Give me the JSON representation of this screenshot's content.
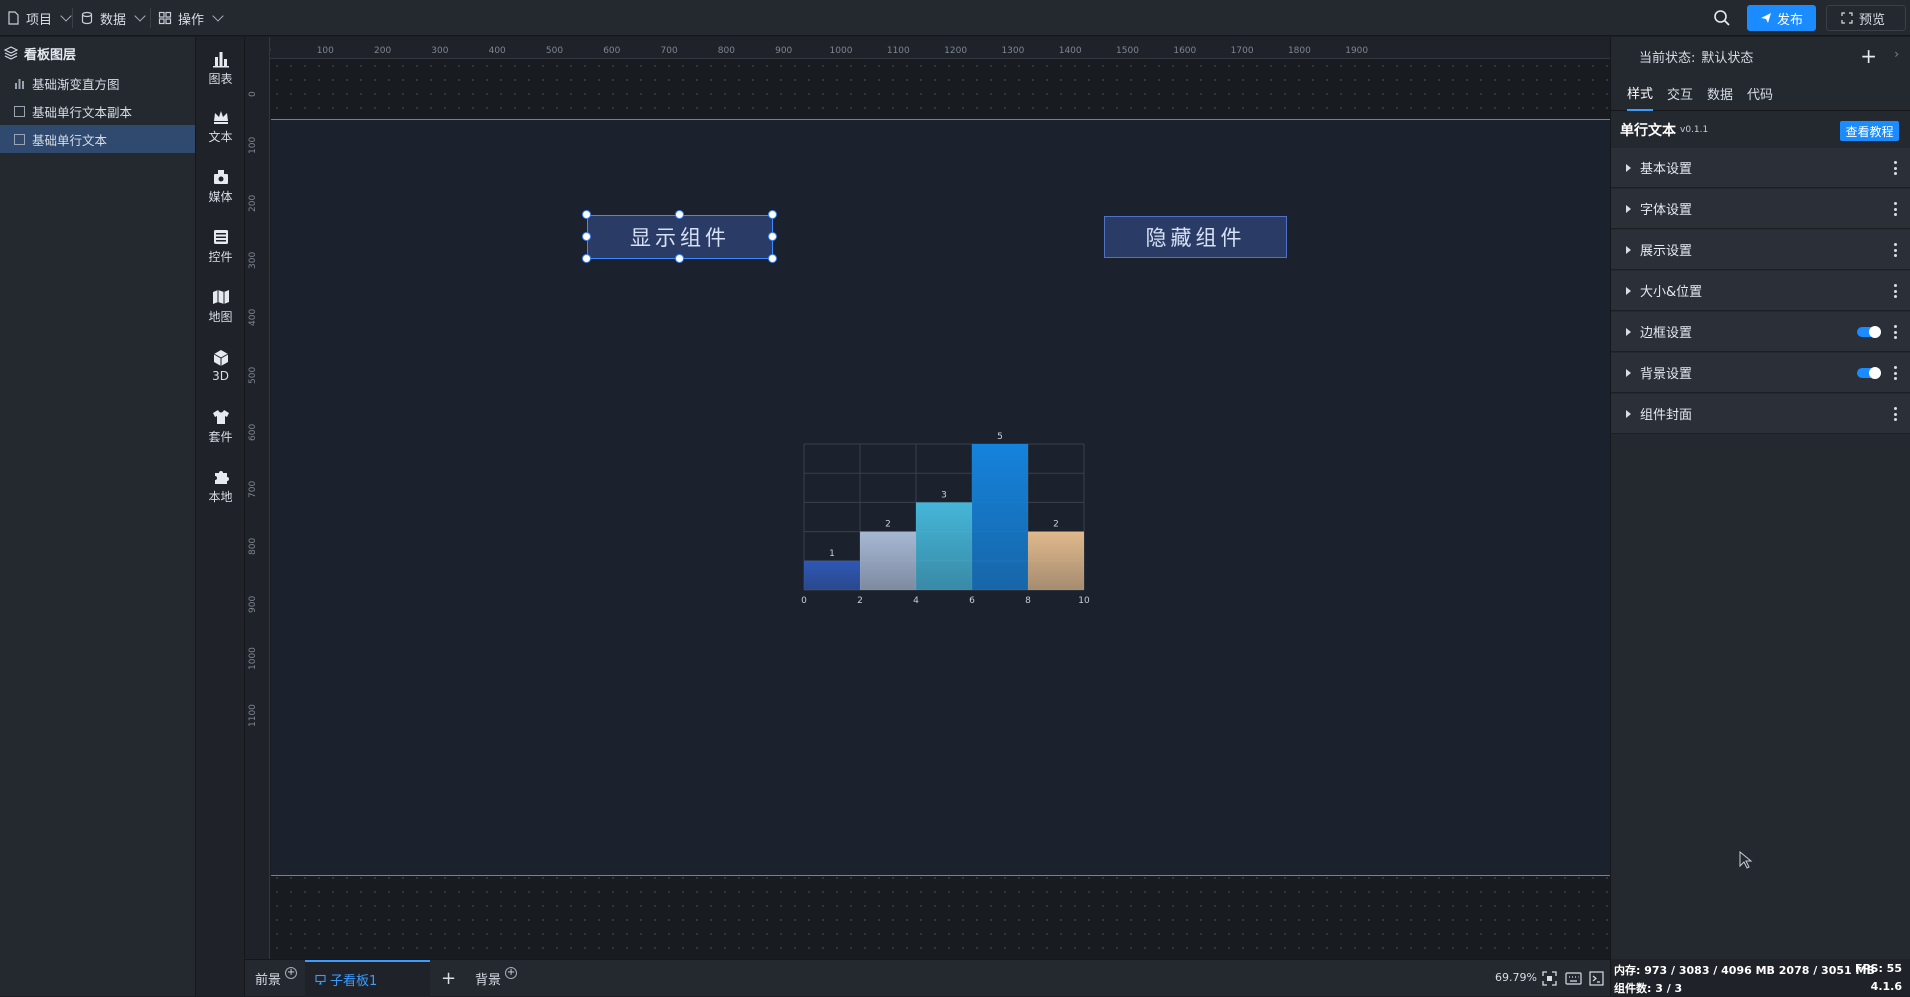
{
  "topbar": {
    "menu": [
      {
        "label": "项目",
        "icon": "file-icon"
      },
      {
        "label": "数据",
        "icon": "database-icon"
      },
      {
        "label": "操作",
        "icon": "grid-icon"
      }
    ],
    "publish_label": "发布",
    "preview_label": "预览"
  },
  "layers": {
    "title": "看板图层",
    "items": [
      {
        "label": "基础渐变直方图",
        "icon": "bar-chart-icon"
      },
      {
        "label": "基础单行文本副本",
        "icon": "text-icon"
      },
      {
        "label": "基础单行文本",
        "icon": "text-icon"
      }
    ]
  },
  "toolbox": {
    "items": [
      {
        "label": "图表",
        "icon": "chart-icon"
      },
      {
        "label": "文本",
        "icon": "crown-icon"
      },
      {
        "label": "媒体",
        "icon": "media-icon"
      },
      {
        "label": "控件",
        "icon": "widget-icon"
      },
      {
        "label": "地图",
        "icon": "map-icon"
      },
      {
        "label": "3D",
        "icon": "cube-icon"
      },
      {
        "label": "套件",
        "icon": "shirt-icon"
      },
      {
        "label": "本地",
        "icon": "puzzle-icon"
      }
    ]
  },
  "ruler": {
    "top": [
      "0",
      "100",
      "200",
      "300",
      "400",
      "500",
      "600",
      "700",
      "800",
      "900",
      "1000",
      "1100",
      "1200",
      "1300",
      "1400",
      "1500",
      "1600",
      "1700",
      "1800",
      "1900"
    ],
    "left": [
      "0",
      "100",
      "200",
      "300",
      "400",
      "500",
      "600",
      "700",
      "800",
      "900",
      "1000",
      "1100"
    ]
  },
  "canvas": {
    "show_button": "显示组件",
    "hide_button": "隐藏组件"
  },
  "chart_data": {
    "type": "bar",
    "x_edges": [
      0,
      2,
      4,
      6,
      8,
      10
    ],
    "x_ticks": [
      "0",
      "2",
      "4",
      "6",
      "8",
      "10"
    ],
    "values": [
      1,
      2,
      3,
      5,
      2
    ],
    "data_labels": [
      "1",
      "2",
      "3",
      "5",
      "2"
    ],
    "ylim": [
      0,
      5
    ],
    "grid": true,
    "colors": [
      "#2f58b6",
      "#a7b8d3",
      "#45b6d9",
      "#1583dc",
      "#e0b98c"
    ]
  },
  "bottombar": {
    "tabs": [
      "前景",
      "子看板1",
      "背景"
    ],
    "zoom": "69.79%"
  },
  "rpanel": {
    "state_label": "当前状态:",
    "state_value": "默认状态",
    "tabs": [
      "样式",
      "交互",
      "数据",
      "代码"
    ],
    "component_name": "单行文本",
    "component_version": "v0.1.1",
    "tutorial_button": "查看教程",
    "sections": [
      "基本设置",
      "字体设置",
      "展示设置",
      "大小&位置",
      "边框设置",
      "背景设置",
      "组件封面"
    ]
  },
  "status": {
    "memory": "内存: 973 / 3083 / 4096 MB  2078 / 3051 MB",
    "fps": "FPS: 55",
    "components": "组件数: 3 / 3",
    "version": "4.1.6"
  }
}
